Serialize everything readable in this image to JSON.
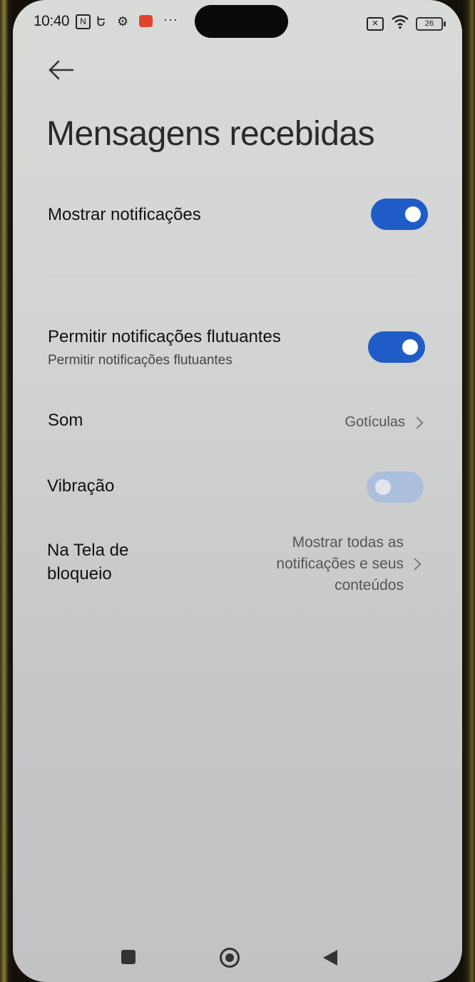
{
  "status_bar": {
    "time": "10:40",
    "nfc_symbol": "N",
    "sync_symbol": "Ե",
    "gear_symbol": "⚙",
    "more_symbol": "···",
    "sim_symbol": "✕",
    "wifi_symbol": "◔",
    "battery": "26"
  },
  "header": {
    "back_icon": "arrow-left-icon",
    "title": "Mensagens recebidas"
  },
  "settings": {
    "show_notifications": {
      "label": "Mostrar notificações",
      "enabled": true
    },
    "floating_notifications": {
      "label": "Permitir notificações flutuantes",
      "subtitle": "Permitir notificações flutuantes",
      "enabled": true
    },
    "sound": {
      "label": "Som",
      "value": "Gotículas"
    },
    "vibration": {
      "label": "Vibração",
      "enabled": false
    },
    "lock_screen": {
      "label_line1": "Na Tela de",
      "label_line2": "bloqueio",
      "value_line1": "Mostrar todas as",
      "value_line2": "notificações e seus",
      "value_line3": "conteúdos"
    }
  },
  "colors": {
    "accent": "#1f5cc7",
    "toggle_disabled": "#a6bddf",
    "background": "#d6d8d7"
  },
  "nav_bar": {
    "recent_icon": "square-icon",
    "home_icon": "circle-icon",
    "back_icon": "triangle-back-icon"
  }
}
